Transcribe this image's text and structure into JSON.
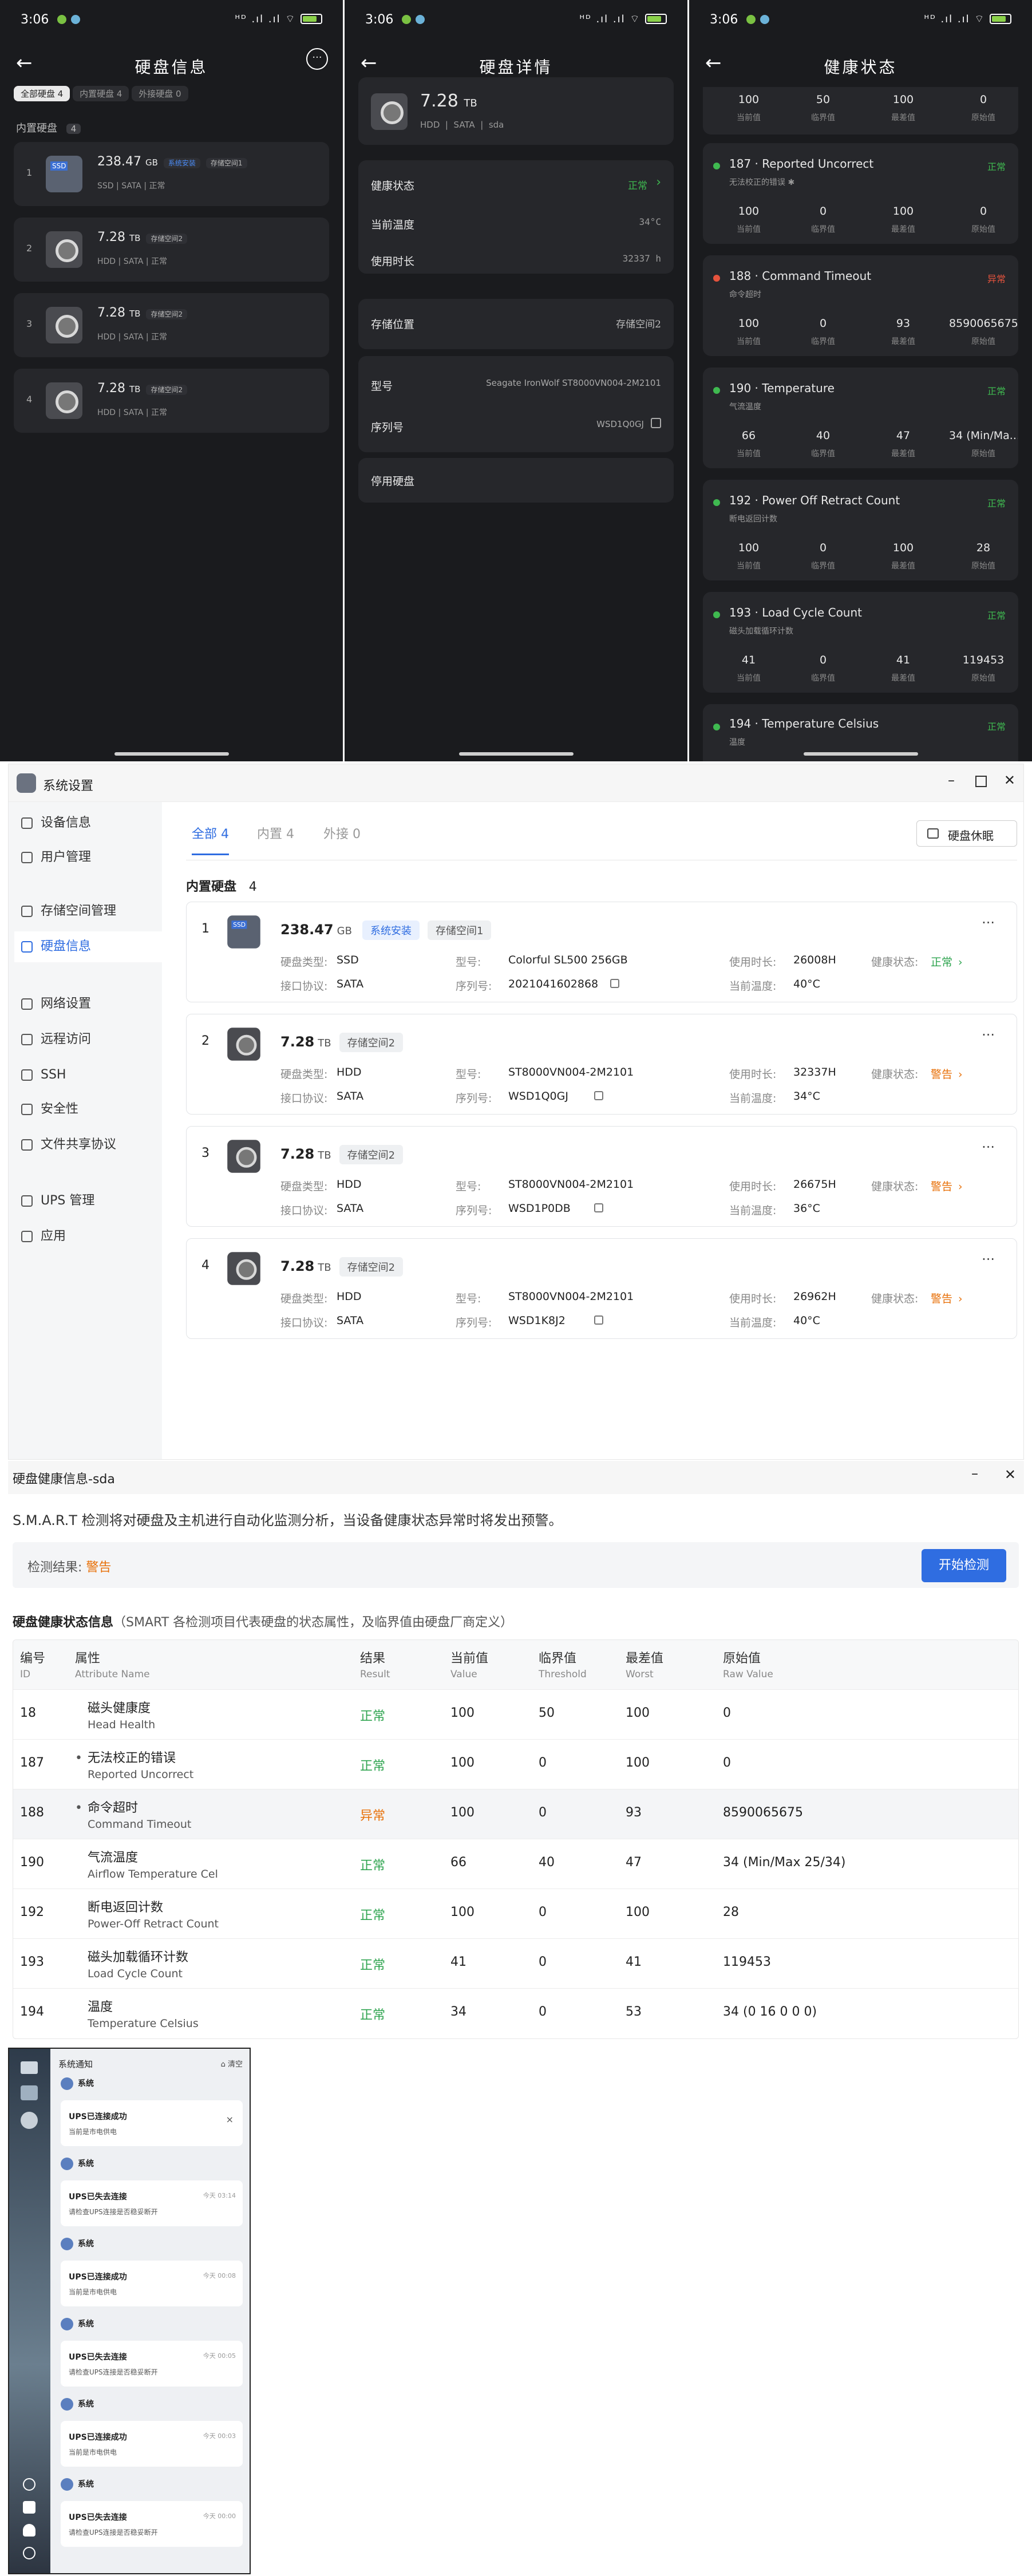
{
  "statusbar": {
    "time": "3:06",
    "right": "ᴴᴰ .ıl .ıl ⌔"
  },
  "phone1": {
    "title": "硬盘信息",
    "tabs": [
      "全部硬盘 4",
      "内置硬盘 4",
      "外接硬盘 0"
    ],
    "section": "内置硬盘",
    "section_count": "4",
    "disks": [
      {
        "idx": "1",
        "size": "238.47",
        "unit": "GB",
        "tags": [
          "系统安装",
          "存储空间1"
        ],
        "type": "SSD",
        "iface": "SATA",
        "health": "正常"
      },
      {
        "idx": "2",
        "size": "7.28",
        "unit": "TB",
        "tags": [
          "存储空间2"
        ],
        "type": "HDD",
        "iface": "SATA",
        "health": "正常"
      },
      {
        "idx": "3",
        "size": "7.28",
        "unit": "TB",
        "tags": [
          "存储空间2"
        ],
        "type": "HDD",
        "iface": "SATA",
        "health": "正常"
      },
      {
        "idx": "4",
        "size": "7.28",
        "unit": "TB",
        "tags": [
          "存储空间2"
        ],
        "type": "HDD",
        "iface": "SATA",
        "health": "正常"
      }
    ]
  },
  "phone2": {
    "title": "硬盘详情",
    "size": "7.28",
    "unit": "TB",
    "type": "HDD",
    "iface": "SATA",
    "dev": "sda",
    "rows1": [
      {
        "label": "健康状态",
        "value": "正常"
      },
      {
        "label": "当前温度",
        "value": "34°C"
      },
      {
        "label": "使用时长",
        "value": "32337 h"
      }
    ],
    "storage_label": "存储位置",
    "storage_value": "存储空间2",
    "model_label": "型号",
    "model_value": "Seagate IronWolf ST8000VN004-2M2101",
    "serial_label": "序列号",
    "serial_value": "WSD1Q0GJ",
    "disable": "停用硬盘"
  },
  "phone3": {
    "title": "健康状态",
    "labels": [
      "当前值",
      "临界值",
      "最差值",
      "原始值"
    ],
    "top_values": [
      "100",
      "50",
      "100",
      "0"
    ],
    "items": [
      {
        "name": "187 · Reported Uncorrect",
        "desc": "无法校正的错误 ✱",
        "status": "正常",
        "status_color": "#3fb950",
        "vals": [
          "100",
          "0",
          "100",
          "0"
        ]
      },
      {
        "name": "188 · Command Timeout",
        "desc": "命令超时",
        "status": "异常",
        "status_color": "#e5533d",
        "vals": [
          "100",
          "0",
          "93",
          "8590065675"
        ]
      },
      {
        "name": "190 · Temperature",
        "desc": "气流温度",
        "status": "正常",
        "status_color": "#3fb950",
        "vals": [
          "66",
          "40",
          "47",
          "34 (Min/Ma..."
        ]
      },
      {
        "name": "192 · Power Off Retract Count",
        "desc": "断电返回计数",
        "status": "正常",
        "status_color": "#3fb950",
        "vals": [
          "100",
          "0",
          "100",
          "28"
        ]
      },
      {
        "name": "193 · Load Cycle Count",
        "desc": "磁头加载循环计数",
        "status": "正常",
        "status_color": "#3fb950",
        "vals": [
          "41",
          "0",
          "41",
          "119453"
        ]
      }
    ],
    "last": {
      "name": "194 · Temperature Celsius",
      "desc": "温度",
      "status": "正常"
    }
  },
  "desktop": {
    "title": "系统设置",
    "sidebar": [
      {
        "label": "设备信息"
      },
      {
        "label": "用户管理"
      },
      {
        "label": "存储空间管理"
      },
      {
        "label": "硬盘信息"
      },
      {
        "label": "网络设置"
      },
      {
        "label": "远程访问"
      },
      {
        "label": "SSH"
      },
      {
        "label": "安全性"
      },
      {
        "label": "文件共享协议"
      },
      {
        "label": "UPS 管理"
      },
      {
        "label": "应用"
      }
    ],
    "tabs": [
      "全部 4",
      "内置 4",
      "外接 0"
    ],
    "sleep_button": "硬盘休眠",
    "section": "内置硬盘",
    "section_count": "4",
    "labels": {
      "type": "硬盘类型:",
      "iface": "接口协议:",
      "model": "型号:",
      "serial": "序列号:",
      "hours": "使用时长:",
      "temp": "当前温度:",
      "health": "健康状态:"
    },
    "disks": [
      {
        "idx": "1",
        "size": "238.47",
        "unit": "GB",
        "sys": "系统安装",
        "tag": "存储空间1",
        "type": "SSD",
        "iface": "SATA",
        "model": "Colorful SL500 256GB",
        "serial": "2021041602868",
        "hours": "26008H",
        "temp": "40°C",
        "health": "正常",
        "health_color": "#2ea44f"
      },
      {
        "idx": "2",
        "size": "7.28",
        "unit": "TB",
        "sys": "",
        "tag": "存储空间2",
        "type": "HDD",
        "iface": "SATA",
        "model": "ST8000VN004-2M2101",
        "serial": "WSD1Q0GJ",
        "hours": "32337H",
        "temp": "34°C",
        "health": "警告",
        "health_color": "#e8710a"
      },
      {
        "idx": "3",
        "size": "7.28",
        "unit": "TB",
        "sys": "",
        "tag": "存储空间2",
        "type": "HDD",
        "iface": "SATA",
        "model": "ST8000VN004-2M2101",
        "serial": "WSD1P0DB",
        "hours": "26675H",
        "temp": "36°C",
        "health": "警告",
        "health_color": "#e8710a"
      },
      {
        "idx": "4",
        "size": "7.28",
        "unit": "TB",
        "sys": "",
        "tag": "存储空间2",
        "type": "HDD",
        "iface": "SATA",
        "model": "ST8000VN004-2M2101",
        "serial": "WSD1K8J2",
        "hours": "26962H",
        "temp": "40°C",
        "health": "警告",
        "health_color": "#e8710a"
      }
    ]
  },
  "smart": {
    "title": "硬盘健康信息-sda",
    "intro": "S.M.A.R.T 检测将对硬盘及主机进行自动化监测分析，当设备健康状态异常时将发出预警。",
    "result_label": "检测结果:",
    "result_value": "警告",
    "start_button": "开始检测",
    "heading": "硬盘健康状态信息",
    "heading_note": "（SMART 各检测项目代表硬盘的状态属性，及临界值由硬盘厂商定义）",
    "columns": [
      {
        "cn": "编号",
        "en": "ID"
      },
      {
        "cn": "属性",
        "en": "Attribute Name"
      },
      {
        "cn": "结果",
        "en": "Result"
      },
      {
        "cn": "当前值",
        "en": "Value"
      },
      {
        "cn": "临界值",
        "en": "Threshold"
      },
      {
        "cn": "最差值",
        "en": "Worst"
      },
      {
        "cn": "原始值",
        "en": "Raw Value"
      }
    ],
    "rows": [
      {
        "id": "18",
        "cn": "磁头健康度",
        "en": "Head Health",
        "res": "正常",
        "val": "100",
        "thr": "50",
        "worst": "100",
        "raw": "0",
        "color": "#2ea44f",
        "bullet": ""
      },
      {
        "id": "187",
        "cn": "无法校正的错误",
        "en": "Reported Uncorrect",
        "res": "正常",
        "val": "100",
        "thr": "0",
        "worst": "100",
        "raw": "0",
        "color": "#2ea44f",
        "bullet": "•"
      },
      {
        "id": "188",
        "cn": "命令超时",
        "en": "Command Timeout",
        "res": "异常",
        "val": "100",
        "thr": "0",
        "worst": "93",
        "raw": "8590065675",
        "color": "#e8710a",
        "bullet": "•"
      },
      {
        "id": "190",
        "cn": "气流温度",
        "en": "Airflow Temperature Cel",
        "res": "正常",
        "val": "66",
        "thr": "40",
        "worst": "47",
        "raw": "34 (Min/Max 25/34)",
        "color": "#2ea44f",
        "bullet": ""
      },
      {
        "id": "192",
        "cn": "断电返回计数",
        "en": "Power-Off Retract Count",
        "res": "正常",
        "val": "100",
        "thr": "0",
        "worst": "100",
        "raw": "28",
        "color": "#2ea44f",
        "bullet": ""
      },
      {
        "id": "193",
        "cn": "磁头加载循环计数",
        "en": "Load Cycle Count",
        "res": "正常",
        "val": "41",
        "thr": "0",
        "worst": "41",
        "raw": "119453",
        "color": "#2ea44f",
        "bullet": ""
      },
      {
        "id": "194",
        "cn": "温度",
        "en": "Temperature Celsius",
        "res": "正常",
        "val": "34",
        "thr": "0",
        "worst": "53",
        "raw": "34 (0 16 0 0 0)",
        "color": "#2ea44f",
        "bullet": ""
      }
    ]
  },
  "notifications": {
    "title": "系统通知",
    "clear": "清空",
    "items": [
      {
        "src": "系统",
        "title": "UPS已连接成功",
        "body": "当前是市电供电",
        "time": "",
        "closable": true
      },
      {
        "src": "系统",
        "title": "UPS已失去连接",
        "body": "请检查UPS连接是否稳妥断开",
        "time": "今天 03:14",
        "closable": false
      },
      {
        "src": "系统",
        "title": "UPS已连接成功",
        "body": "当前是市电供电",
        "time": "今天 00:08",
        "closable": false
      },
      {
        "src": "系统",
        "title": "UPS已失去连接",
        "body": "请检查UPS连接是否稳妥断开",
        "time": "今天 00:05",
        "closable": false
      },
      {
        "src": "系统",
        "title": "UPS已连接成功",
        "body": "当前是市电供电",
        "time": "今天 00:03",
        "closable": false
      },
      {
        "src": "系统",
        "title": "UPS已失去连接",
        "body": "请检查UPS连接是否稳妥断开",
        "time": "今天 00:00",
        "closable": false
      }
    ]
  }
}
